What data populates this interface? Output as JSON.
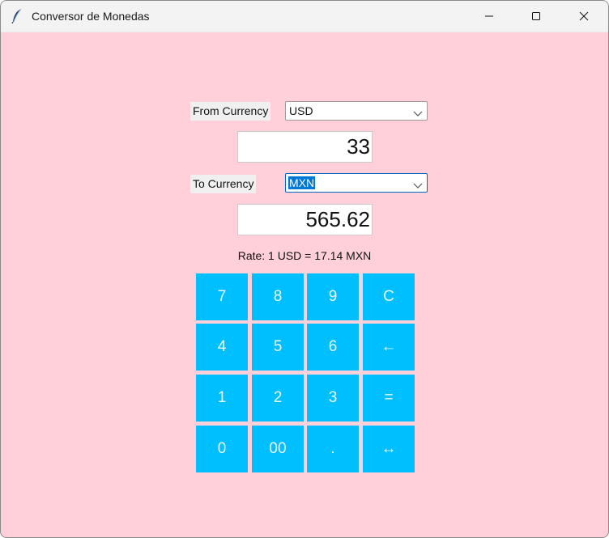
{
  "window": {
    "title": "Conversor de Monedas"
  },
  "form": {
    "from_label": "From Currency",
    "from_currency": "USD",
    "amount": "33",
    "to_label": "To Currency",
    "to_currency": "MXN",
    "result": "565.62",
    "rate_text": "Rate: 1 USD = 17.14 MXN"
  },
  "keypad": {
    "keys": [
      "7",
      "8",
      "9",
      "C",
      "4",
      "5",
      "6",
      "←",
      "1",
      "2",
      "3",
      "=",
      "0",
      "00",
      ".",
      "↔"
    ]
  },
  "colors": {
    "background": "#ffd0d9",
    "key": "#00bfff",
    "selection": "#0078d7"
  },
  "icons": {
    "app": "feather-icon",
    "minimize": "minimize-icon",
    "maximize": "maximize-icon",
    "close": "close-icon",
    "dropdown": "chevron-down-icon"
  }
}
